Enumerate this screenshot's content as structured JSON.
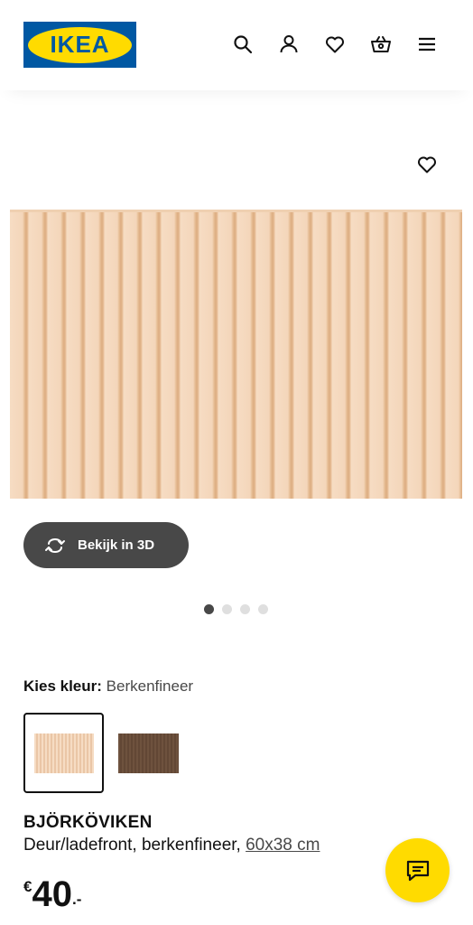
{
  "header": {
    "logo_text": "IKEA",
    "icons": [
      "search-icon",
      "account-icon",
      "heart-icon",
      "basket-icon",
      "menu-icon"
    ]
  },
  "gallery": {
    "favorite_icon": "heart-icon",
    "view_3d_label": "Bekijk in 3D",
    "dots_total": 4,
    "dots_active_index": 0
  },
  "color": {
    "label": "Kies kleur:",
    "value": "Berkenfineer",
    "swatches": [
      {
        "name": "Berkenfineer",
        "color": "#f4d8bd",
        "selected": true
      },
      {
        "name": "dark",
        "color": "#6b4e3a",
        "selected": false
      }
    ]
  },
  "product": {
    "name": "BJÖRKÖVIKEN",
    "description": "Deur/ladefront, berkenfineer, ",
    "dimensions": "60x38 cm",
    "currency": "€",
    "price": "40",
    "price_suffix": ".-"
  },
  "colors": {
    "ikea_blue": "#0058a3",
    "ikea_yellow": "#ffdb00",
    "button_dark": "#484848"
  }
}
